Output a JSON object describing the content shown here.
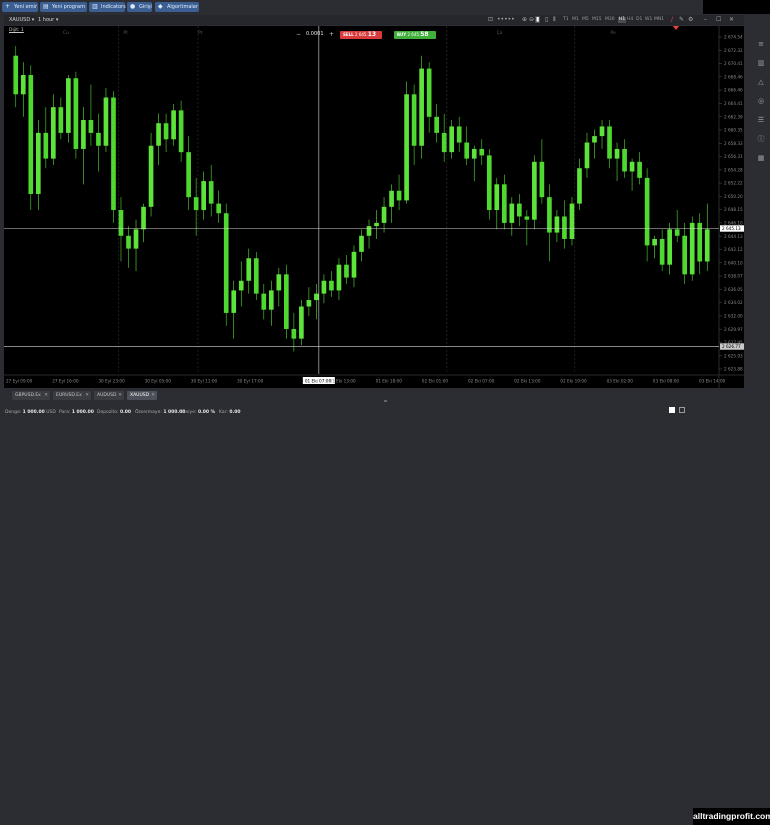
{
  "top_buttons": [
    {
      "label": "Yeni emir",
      "icon": "plus-icon"
    },
    {
      "label": "Yeni program",
      "icon": "program-icon"
    },
    {
      "label": "Indicators",
      "icon": "indicators-icon"
    },
    {
      "label": "Girişi",
      "icon": "user-icon"
    },
    {
      "label": "Algoritmalar",
      "icon": "algo-icon"
    }
  ],
  "symbol": "XAUUSD",
  "timeframe_select": "1 hour",
  "timeframes": [
    "T1",
    "M1",
    "M5",
    "M15",
    "M30",
    "H1",
    "H4",
    "D1",
    "W1",
    "MN1"
  ],
  "active_timeframe": "H1",
  "chart_label": "Dijit: 1",
  "trade_panel": {
    "volume": "0.0001",
    "sell_label": "SELL",
    "sell_price_small": "2 645.",
    "sell_price_big": "13",
    "buy_label": "BUY",
    "buy_price_small": "2 645.",
    "buy_price_big": "58",
    "minus": "−",
    "plus": "+"
  },
  "top_axis_labels": [
    {
      "text": "Cu",
      "x": 0.08
    },
    {
      "text": "Pt",
      "x": 0.165
    },
    {
      "text": "Pt",
      "x": 0.27
    },
    {
      "text": "Ça",
      "x": 0.69
    },
    {
      "text": "Pe",
      "x": 0.85
    }
  ],
  "price_labels": [
    "2 674.54",
    "2 672.32",
    "2 670.41",
    "2 668.46",
    "2 666.46",
    "2 664.41",
    "2 662.39",
    "2 660.35",
    "2 658.33",
    "2 656.31",
    "2 654.28",
    "2 652.22",
    "2 650.20",
    "2 648.15",
    "2 646.10",
    "2 644.13",
    "2 642.12",
    "2 640.10",
    "2 638.07",
    "2 636.05",
    "2 634.02",
    "2 632.00",
    "2 629.97",
    "2 627.95",
    "2 625.93",
    "2 623.88"
  ],
  "crosshair_price": "2 645.13",
  "lower_line_price": "2 626.77",
  "time_labels": [
    "27 Eyl 09:00",
    "27 Eyl 16:00",
    "30 Eyl 23:00",
    "30 Eyl 05:00",
    "30 Eyl 11:00",
    "30 Eyl 17:00",
    "01 Eki 07:00",
    "01 Eki 13:00",
    "01 Eki 18:00",
    "02 Eki 01:00",
    "02 Eki 07:00",
    "02 Eki 13:00",
    "02 Eki 19:00",
    "03 Eki 02:00",
    "03 Eki 08:00",
    "03 Eki 14:00"
  ],
  "crosshair_time": "01 Eki 07:00",
  "tabs": [
    {
      "label": "GBPUSD.Ex",
      "active": false
    },
    {
      "label": "EURUSD.Ex",
      "active": false
    },
    {
      "label": "AUDUSD",
      "active": false
    },
    {
      "label": "XAUUSD",
      "active": true
    }
  ],
  "status": [
    {
      "label": "Denge:",
      "value": "1 000.00",
      "unit": "USD"
    },
    {
      "label": "Para:",
      "value": "1 000.00"
    },
    {
      "label": "Depozito:",
      "value": "0.00"
    },
    {
      "label": "Özsermaye:",
      "value": "1 000.00"
    },
    {
      "label": "Seviye:",
      "value": "0.00 %"
    },
    {
      "label": "Kar:",
      "value": "0.00"
    }
  ],
  "watermark": "alltradingprofit.com",
  "colors": {
    "bull": "#5ee33b",
    "bear": "#4fd82f",
    "background": "#000000",
    "accent": "#3b5f93",
    "sell": "#d83b3b",
    "buy": "#3fae3a",
    "marker": "#e0463a"
  },
  "chart_data": {
    "type": "candlestick",
    "symbol": "XAUUSD",
    "timeframe": "H1",
    "ylim": [
      2622.5,
      2676.0
    ],
    "horizontal_lines": [
      2645.13,
      2626.77
    ],
    "candles": [
      [
        2672.0,
        2673.5,
        2664.0,
        2666.0
      ],
      [
        2666.0,
        2671.0,
        2662.5,
        2669.0
      ],
      [
        2669.0,
        2670.5,
        2648.0,
        2650.5
      ],
      [
        2650.5,
        2662.0,
        2648.0,
        2660.0
      ],
      [
        2660.0,
        2664.0,
        2654.5,
        2656.0
      ],
      [
        2656.0,
        2666.0,
        2655.0,
        2664.0
      ],
      [
        2664.0,
        2665.5,
        2659.0,
        2660.0
      ],
      [
        2660.0,
        2669.0,
        2658.5,
        2668.5
      ],
      [
        2668.5,
        2669.5,
        2656.0,
        2657.5
      ],
      [
        2657.5,
        2664.0,
        2652.0,
        2662.0
      ],
      [
        2662.0,
        2667.5,
        2658.0,
        2660.0
      ],
      [
        2660.0,
        2663.0,
        2654.0,
        2658.0
      ],
      [
        2658.0,
        2667.0,
        2657.0,
        2665.5
      ],
      [
        2665.5,
        2666.5,
        2646.0,
        2648.0
      ],
      [
        2648.0,
        2650.0,
        2640.0,
        2644.0
      ],
      [
        2644.0,
        2645.5,
        2639.0,
        2642.0
      ],
      [
        2642.0,
        2646.5,
        2638.5,
        2645.0
      ],
      [
        2645.0,
        2649.0,
        2643.0,
        2648.5
      ],
      [
        2648.5,
        2660.0,
        2647.0,
        2658.0
      ],
      [
        2658.0,
        2663.0,
        2655.0,
        2661.5
      ],
      [
        2661.5,
        2663.0,
        2657.0,
        2659.0
      ],
      [
        2659.0,
        2664.5,
        2658.0,
        2663.5
      ],
      [
        2663.5,
        2665.0,
        2655.5,
        2657.0
      ],
      [
        2657.0,
        2659.5,
        2648.0,
        2650.0
      ],
      [
        2650.0,
        2653.0,
        2644.0,
        2648.0
      ],
      [
        2648.0,
        2654.0,
        2646.5,
        2652.5
      ],
      [
        2652.5,
        2655.0,
        2647.0,
        2649.0
      ],
      [
        2649.0,
        2651.0,
        2646.0,
        2647.5
      ],
      [
        2647.5,
        2649.0,
        2630.0,
        2632.0
      ],
      [
        2632.0,
        2637.0,
        2628.0,
        2635.5
      ],
      [
        2635.5,
        2640.0,
        2633.0,
        2637.0
      ],
      [
        2637.0,
        2642.0,
        2635.0,
        2640.5
      ],
      [
        2640.5,
        2641.5,
        2634.0,
        2635.0
      ],
      [
        2635.0,
        2636.5,
        2631.0,
        2632.5
      ],
      [
        2632.5,
        2637.0,
        2630.0,
        2635.5
      ],
      [
        2635.5,
        2639.0,
        2633.0,
        2638.0
      ],
      [
        2638.0,
        2639.5,
        2628.0,
        2629.5
      ],
      [
        2629.5,
        2632.0,
        2626.0,
        2628.0
      ],
      [
        2628.0,
        2634.0,
        2627.0,
        2633.0
      ],
      [
        2633.0,
        2636.0,
        2631.5,
        2634.0
      ],
      [
        2634.0,
        2636.5,
        2631.0,
        2635.0
      ],
      [
        2635.0,
        2638.0,
        2633.5,
        2637.0
      ],
      [
        2637.0,
        2638.5,
        2634.5,
        2635.5
      ],
      [
        2635.5,
        2640.5,
        2634.0,
        2639.5
      ],
      [
        2639.5,
        2641.0,
        2636.5,
        2637.5
      ],
      [
        2637.5,
        2642.5,
        2636.0,
        2641.5
      ],
      [
        2641.5,
        2645.0,
        2640.0,
        2644.0
      ],
      [
        2644.0,
        2646.5,
        2642.0,
        2645.5
      ],
      [
        2645.5,
        2648.0,
        2643.5,
        2646.0
      ],
      [
        2646.0,
        2650.0,
        2644.5,
        2648.5
      ],
      [
        2648.5,
        2652.0,
        2646.0,
        2651.0
      ],
      [
        2651.0,
        2653.5,
        2648.0,
        2649.5
      ],
      [
        2649.5,
        2668.0,
        2649.0,
        2666.0
      ],
      [
        2666.0,
        2667.5,
        2655.0,
        2658.0
      ],
      [
        2658.0,
        2672.0,
        2656.0,
        2670.0
      ],
      [
        2670.0,
        2671.0,
        2660.0,
        2662.5
      ],
      [
        2662.5,
        2664.5,
        2658.5,
        2660.0
      ],
      [
        2660.0,
        2663.0,
        2655.5,
        2657.0
      ],
      [
        2657.0,
        2662.0,
        2656.0,
        2661.0
      ],
      [
        2661.0,
        2662.5,
        2657.0,
        2658.5
      ],
      [
        2658.5,
        2661.0,
        2655.0,
        2656.0
      ],
      [
        2656.0,
        2658.0,
        2652.5,
        2657.5
      ],
      [
        2657.5,
        2659.0,
        2655.0,
        2656.5
      ],
      [
        2656.5,
        2657.5,
        2646.5,
        2648.0
      ],
      [
        2648.0,
        2653.0,
        2645.0,
        2652.0
      ],
      [
        2652.0,
        2653.5,
        2645.0,
        2646.0
      ],
      [
        2646.0,
        2650.0,
        2644.0,
        2649.0
      ],
      [
        2649.0,
        2650.5,
        2645.5,
        2647.0
      ],
      [
        2647.0,
        2648.0,
        2642.5,
        2646.5
      ],
      [
        2646.5,
        2656.5,
        2645.0,
        2655.5
      ],
      [
        2655.5,
        2659.0,
        2649.0,
        2650.0
      ],
      [
        2650.0,
        2652.0,
        2640.0,
        2644.5
      ],
      [
        2644.5,
        2648.0,
        2643.0,
        2647.0
      ],
      [
        2647.0,
        2649.5,
        2642.0,
        2643.5
      ],
      [
        2643.5,
        2650.0,
        2642.5,
        2649.0
      ],
      [
        2649.0,
        2656.0,
        2648.0,
        2654.5
      ],
      [
        2654.5,
        2660.0,
        2653.0,
        2658.5
      ],
      [
        2658.5,
        2660.5,
        2656.0,
        2659.5
      ],
      [
        2659.5,
        2662.0,
        2657.5,
        2661.0
      ],
      [
        2661.0,
        2662.0,
        2654.5,
        2656.0
      ],
      [
        2656.0,
        2658.5,
        2652.5,
        2657.5
      ],
      [
        2657.5,
        2659.0,
        2653.0,
        2654.0
      ],
      [
        2654.0,
        2656.0,
        2651.0,
        2655.5
      ],
      [
        2655.5,
        2657.0,
        2652.0,
        2653.0
      ],
      [
        2653.0,
        2654.5,
        2640.0,
        2642.5
      ],
      [
        2642.5,
        2644.0,
        2640.5,
        2643.5
      ],
      [
        2643.5,
        2645.0,
        2638.5,
        2639.5
      ],
      [
        2639.5,
        2646.0,
        2638.0,
        2645.0
      ],
      [
        2645.0,
        2648.0,
        2643.0,
        2644.0
      ],
      [
        2644.0,
        2646.0,
        2636.5,
        2638.0
      ],
      [
        2638.0,
        2647.0,
        2637.0,
        2646.0
      ],
      [
        2646.0,
        2647.5,
        2638.0,
        2640.0
      ],
      [
        2640.0,
        2649.0,
        2638.5,
        2645.0
      ]
    ]
  }
}
